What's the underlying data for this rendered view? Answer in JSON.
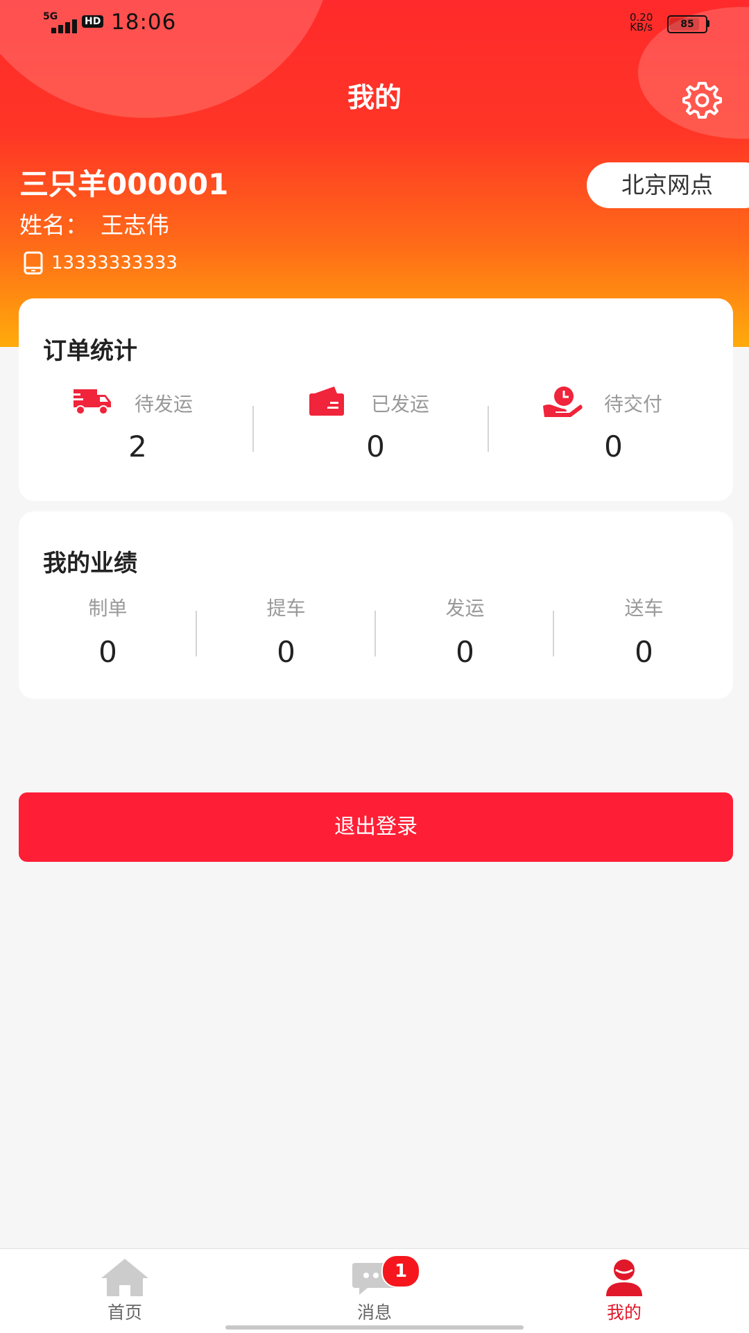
{
  "status_bar": {
    "network": "5G",
    "hd": "HD",
    "time": "18:06",
    "speed_value": "0.20",
    "speed_unit": "KB/s",
    "battery": "85",
    "battery_level": 0.85
  },
  "header": {
    "title": "我的",
    "settings_icon": "gear-icon"
  },
  "profile": {
    "company": "三只羊000001",
    "name_label": "姓名：",
    "name": "王志伟",
    "phone": "13333333333",
    "branch": "北京网点"
  },
  "order_stats": {
    "title": "订单统计",
    "items": [
      {
        "icon": "truck-icon",
        "label": "待发运",
        "value": "2"
      },
      {
        "icon": "wallet-icon",
        "label": "已发运",
        "value": "0"
      },
      {
        "icon": "clock-hand-icon",
        "label": "待交付",
        "value": "0"
      }
    ]
  },
  "performance": {
    "title": "我的业绩",
    "items": [
      {
        "label": "制单",
        "value": "0"
      },
      {
        "label": "提车",
        "value": "0"
      },
      {
        "label": "发运",
        "value": "0"
      },
      {
        "label": "送车",
        "value": "0"
      }
    ]
  },
  "logout_label": "退出登录",
  "tabbar": {
    "items": [
      {
        "icon": "home-icon",
        "label": "首页",
        "active": false
      },
      {
        "icon": "message-icon",
        "label": "消息",
        "active": false,
        "badge": "1"
      },
      {
        "icon": "user-icon",
        "label": "我的",
        "active": true
      }
    ]
  },
  "colors": {
    "accent": "#fe1f36",
    "header_top": "#ff2a2b",
    "header_bottom": "#ffab0b",
    "icon_red": "#f0243a",
    "tab_active": "#e0182a",
    "tab_inactive": "#cccccc"
  }
}
